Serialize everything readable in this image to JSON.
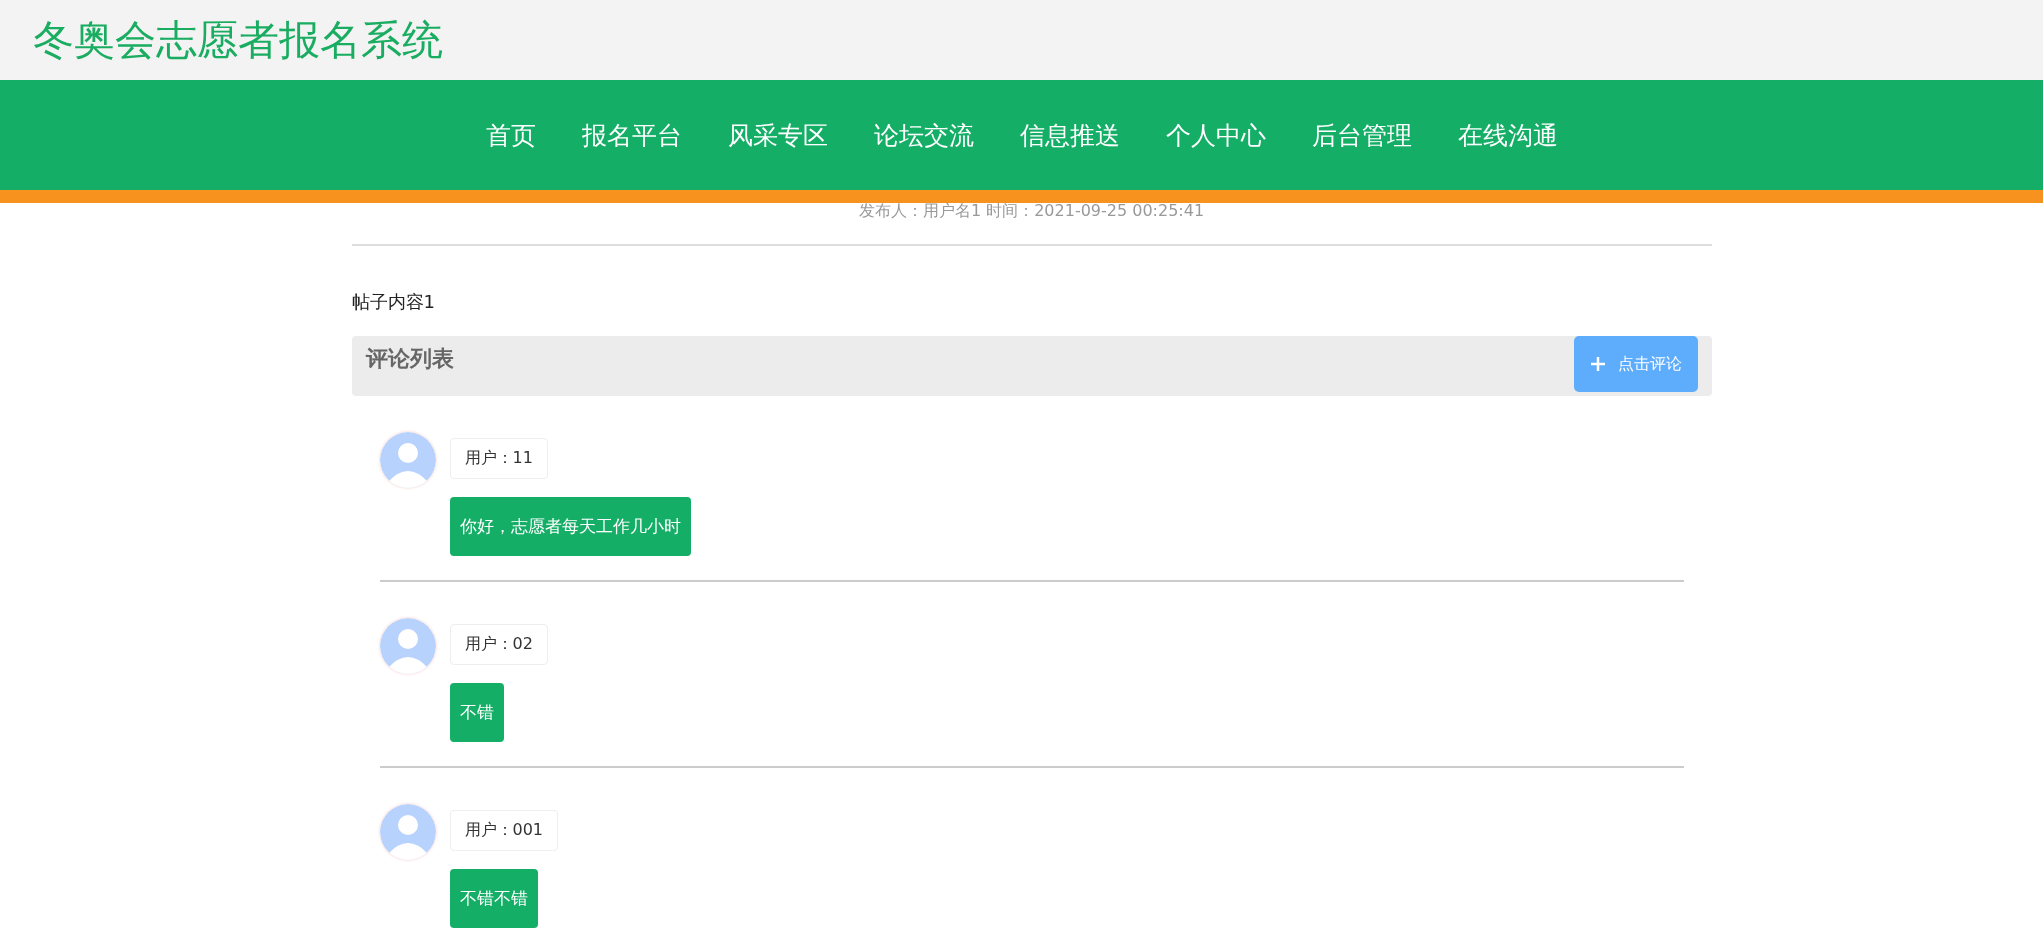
{
  "site_title": "冬奥会志愿者报名系统",
  "nav": [
    {
      "label": "首页"
    },
    {
      "label": "报名平台"
    },
    {
      "label": "风采专区"
    },
    {
      "label": "论坛交流"
    },
    {
      "label": "信息推送"
    },
    {
      "label": "个人中心"
    },
    {
      "label": "后台管理"
    },
    {
      "label": "在线沟通"
    }
  ],
  "post": {
    "meta": "发布人：用户名1 时间：2021-09-25 00:25:41",
    "content": "帖子内容1"
  },
  "comments_header": {
    "title": "评论列表",
    "button": "点击评论"
  },
  "comments": [
    {
      "user": "用户：11",
      "text": "你好，志愿者每天工作几小时"
    },
    {
      "user": "用户：02",
      "text": "不错"
    },
    {
      "user": "用户：001",
      "text": "不错不错"
    }
  ]
}
